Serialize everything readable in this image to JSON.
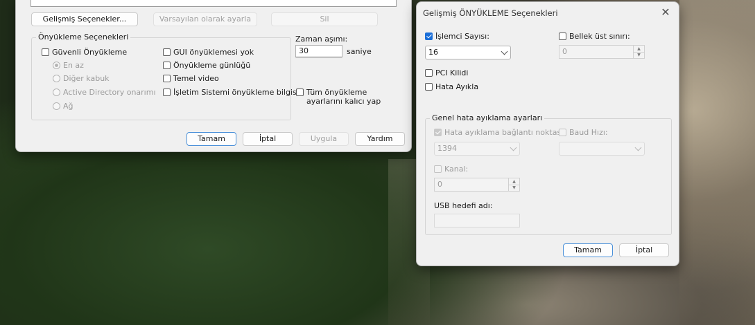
{
  "left_dialog": {
    "buttons_top": {
      "advanced": "Gelişmiş Seçenekler...",
      "set_default": "Varsayılan olarak ayarla",
      "delete": "Sil"
    },
    "boot_options": {
      "title": "Önyükleme Seçenekleri",
      "safe_boot": "Güvenli Önyükleme",
      "radios": [
        "En az",
        "Diğer kabuk",
        "Active Directory onarımı",
        "Ağ"
      ],
      "no_gui": "GUI önyüklemesi yok",
      "boot_log": "Önyükleme günlüğü",
      "base_video": "Temel video",
      "os_boot_info": "İşletim Sistemi önyükleme bilgisi"
    },
    "timeout": {
      "label": "Zaman aşımı:",
      "value": "30",
      "unit": "saniye"
    },
    "make_permanent": "Tüm önyükleme ayarlarını kalıcı yap",
    "buttons_bottom": {
      "ok": "Tamam",
      "cancel": "İptal",
      "apply": "Uygula",
      "help": "Yardım"
    }
  },
  "right_dialog": {
    "title": "Gelişmiş ÖNYÜKLEME Seçenekleri",
    "processor_count": {
      "label": "İşlemci Sayısı:",
      "checked": true,
      "value": "16"
    },
    "max_memory": {
      "label": "Bellek üst sınırı:",
      "checked": false,
      "value": "0"
    },
    "pci_lock": "PCI Kilidi",
    "debug": "Hata Ayıkla",
    "debug_settings": {
      "title": "Genel hata ayıklama ayarları",
      "debug_port": {
        "label": "Hata ayıklama bağlantı noktası:",
        "value": "1394"
      },
      "baud_rate": {
        "label": "Baud Hızı:",
        "value": ""
      },
      "channel": {
        "label": "Kanal:",
        "value": "0"
      },
      "usb_target": {
        "label": "USB hedefi adı:",
        "value": ""
      }
    },
    "buttons": {
      "ok": "Tamam",
      "cancel": "İptal"
    }
  }
}
